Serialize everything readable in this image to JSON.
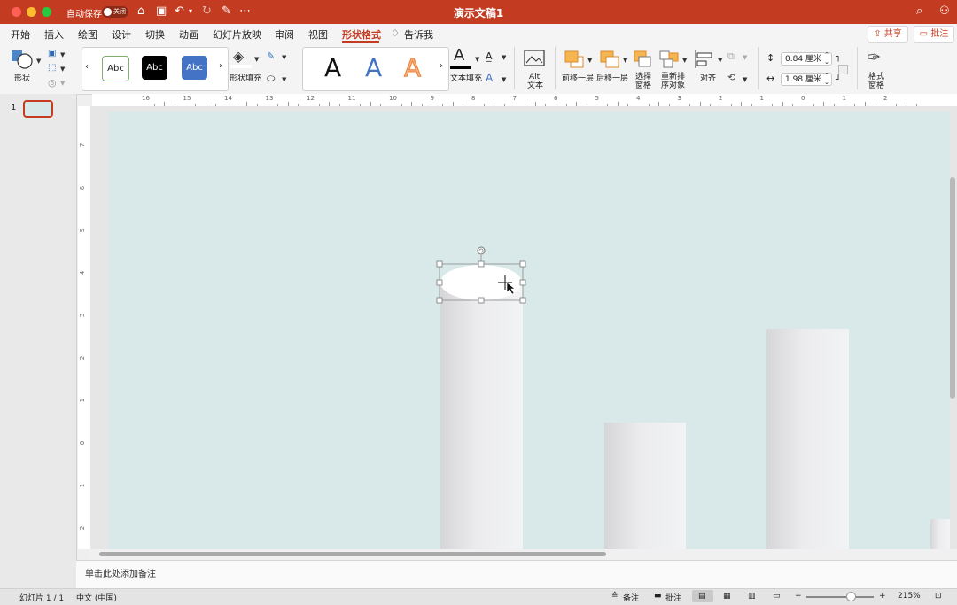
{
  "window": {
    "title": "演示文稿1",
    "autosave_label": "自动保存",
    "autosave_state": "关闭"
  },
  "tabs": [
    "开始",
    "插入",
    "绘图",
    "设计",
    "切换",
    "动画",
    "幻灯片放映",
    "审阅",
    "视图",
    "形状格式"
  ],
  "tell_me": "告诉我",
  "share_label": "共享",
  "comments_label": "批注",
  "ribbon": {
    "shape_label": "形状",
    "style_samples": [
      "Abc",
      "Abc",
      "Abc"
    ],
    "shape_fill_label": "形状填充",
    "wordart_samples": [
      "A",
      "A",
      "A"
    ],
    "text_fill_label": "文本填充",
    "alt_text_label_1": "Alt",
    "alt_text_label_2": "文本",
    "bring_forward_label": "前移一层",
    "send_backward_label": "后移一层",
    "selection_pane_label_1": "选择",
    "selection_pane_label_2": "窗格",
    "reorder_label_1": "重新排",
    "reorder_label_2": "序对象",
    "align_label": "对齐",
    "height_value": "0.84 厘米",
    "width_value": "1.98 厘米",
    "format_pane_label_1": "格式",
    "format_pane_label_2": "窗格"
  },
  "ruler_h_labels": [
    "16",
    "15",
    "14",
    "13",
    "12",
    "11",
    "10",
    "9",
    "8",
    "7",
    "6",
    "5",
    "4",
    "3",
    "2",
    "1",
    "0",
    "1",
    "2"
  ],
  "ruler_v_labels": [
    "7",
    "6",
    "5",
    "4",
    "3",
    "2",
    "1",
    "0",
    "1",
    "2"
  ],
  "slide_panel": {
    "number": "1"
  },
  "notes_placeholder": "单击此处添加备注",
  "status": {
    "slide_count": "幻灯片 1 / 1",
    "language": "中文 (中国)",
    "notes_label": "备注",
    "comments_label": "批注",
    "zoom": "215%"
  },
  "colors": {
    "accent": "#c33c21",
    "slide_bg": "#d9e8e8"
  }
}
